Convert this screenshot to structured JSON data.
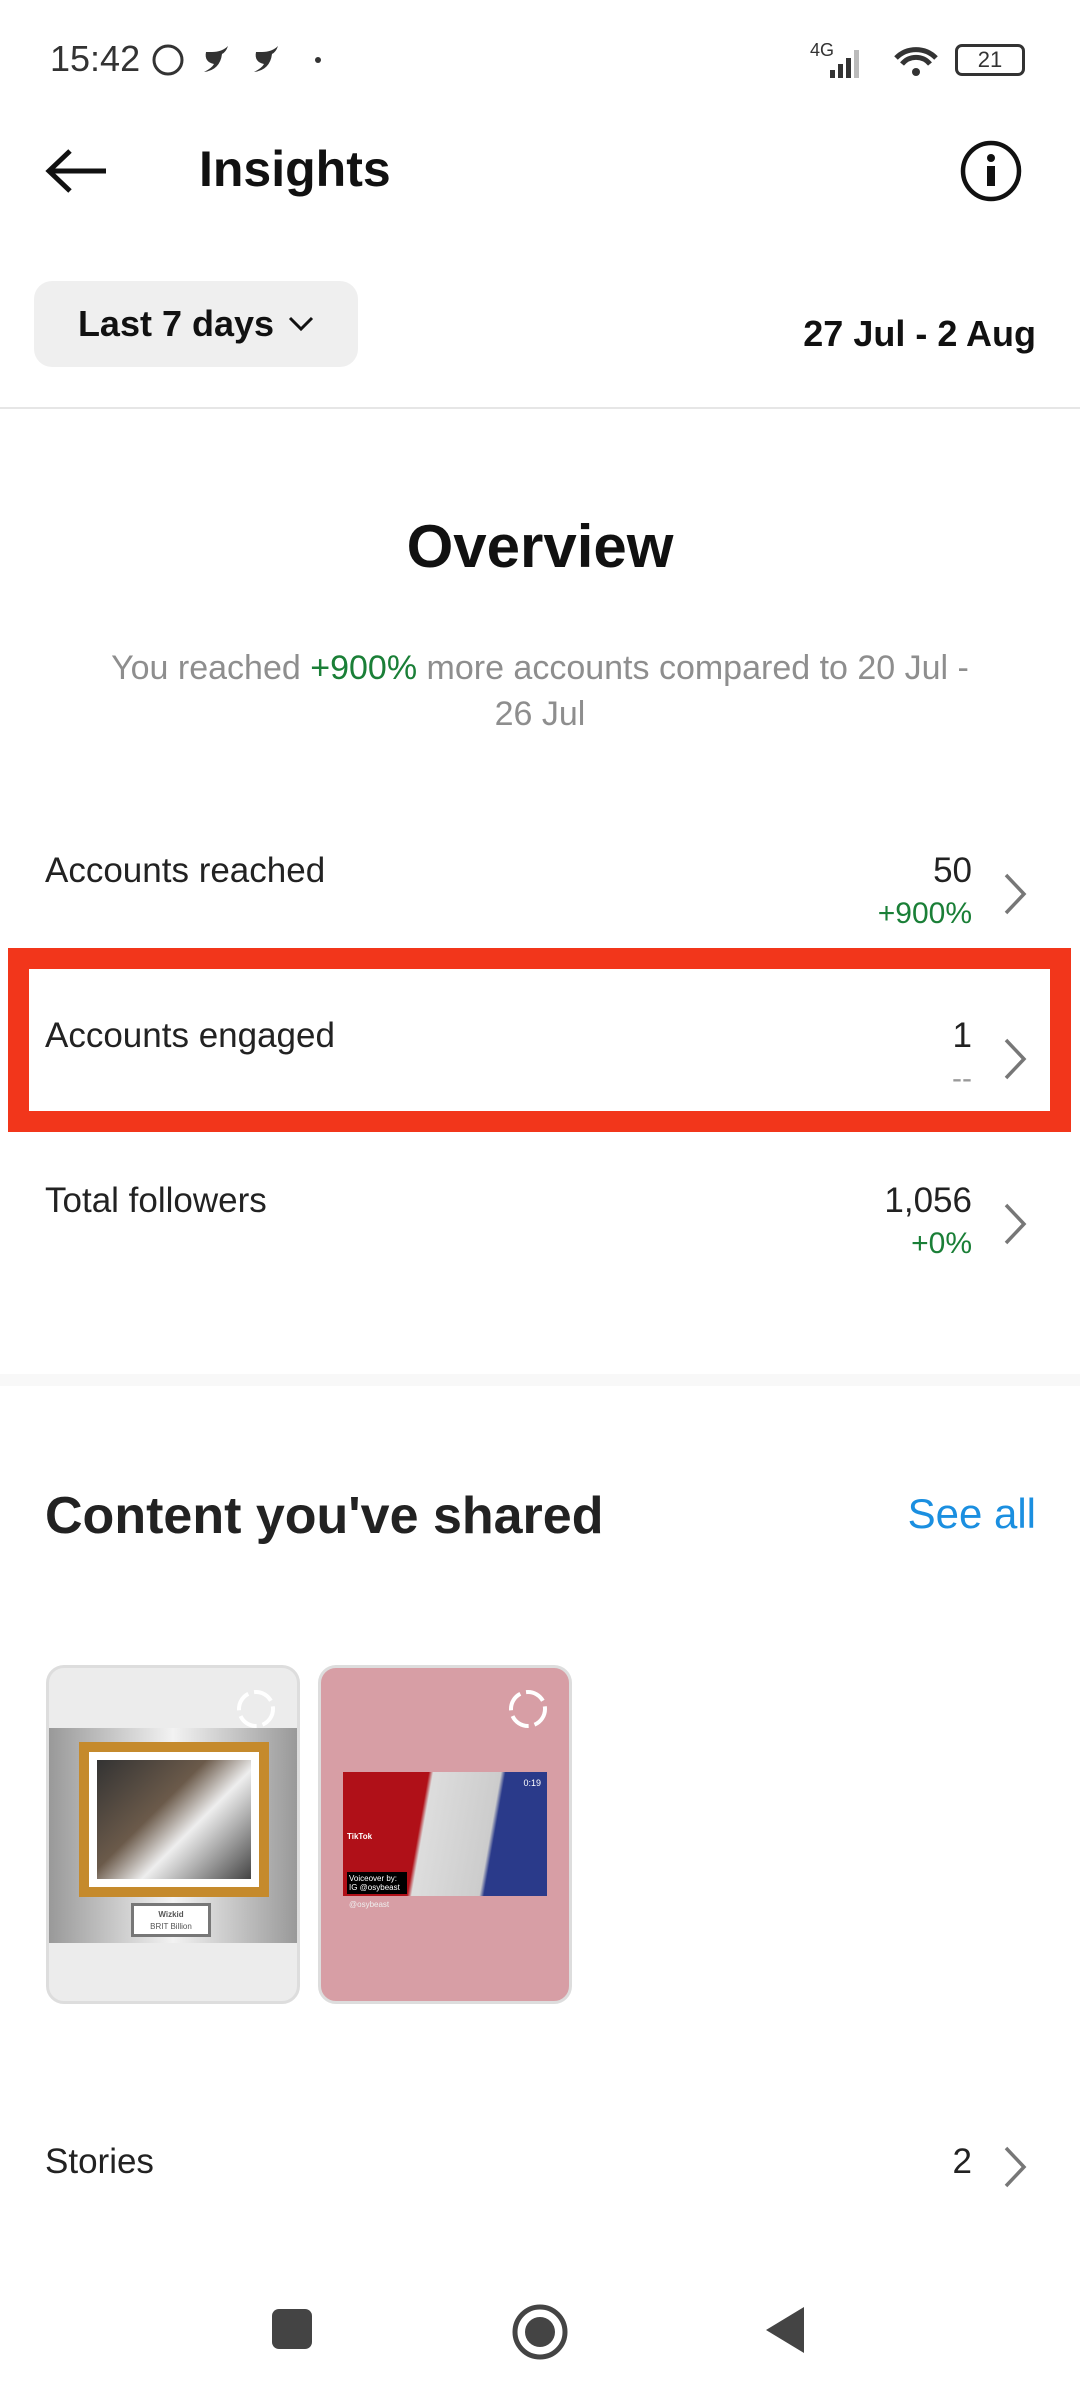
{
  "status_bar": {
    "time": "15:42",
    "network": "4G",
    "battery": "21",
    "icons": [
      "whatsapp-icon",
      "twitter-icon",
      "twitter-icon",
      "dot-icon",
      "signal-icon",
      "wifi-icon",
      "battery-icon"
    ]
  },
  "header": {
    "title": "Insights",
    "back_icon": "arrow-left-icon",
    "info_icon": "info-icon"
  },
  "filter": {
    "selected": "Last 7 days",
    "date_range": "27 Jul - 2 Aug"
  },
  "overview": {
    "title": "Overview",
    "subtitle_pre": "You reached ",
    "subtitle_pct": "+900%",
    "subtitle_post": " more accounts compared to 20 Jul - 26 Jul"
  },
  "metrics": [
    {
      "label": "Accounts reached",
      "value": "50",
      "change": "+900%"
    },
    {
      "label": "Accounts engaged",
      "value": "1",
      "change": "--"
    },
    {
      "label": "Total followers",
      "value": "1,056",
      "change": "+0%"
    }
  ],
  "content": {
    "title": "Content you've shared",
    "see_all": "See all",
    "thumbs": [
      {
        "caption_line1": "Wizkid",
        "caption_line2": "BRIT Billion"
      },
      {
        "duration": "0:19",
        "brand": "TikTok",
        "overlay": "Voiceover by: IG @osybeast",
        "handle": "@osybeast"
      }
    ],
    "stories_label": "Stories",
    "stories_count": "2"
  },
  "colors": {
    "accent": "#1b8fe0",
    "positive": "#1a7f37",
    "highlight": "#f2361b"
  }
}
